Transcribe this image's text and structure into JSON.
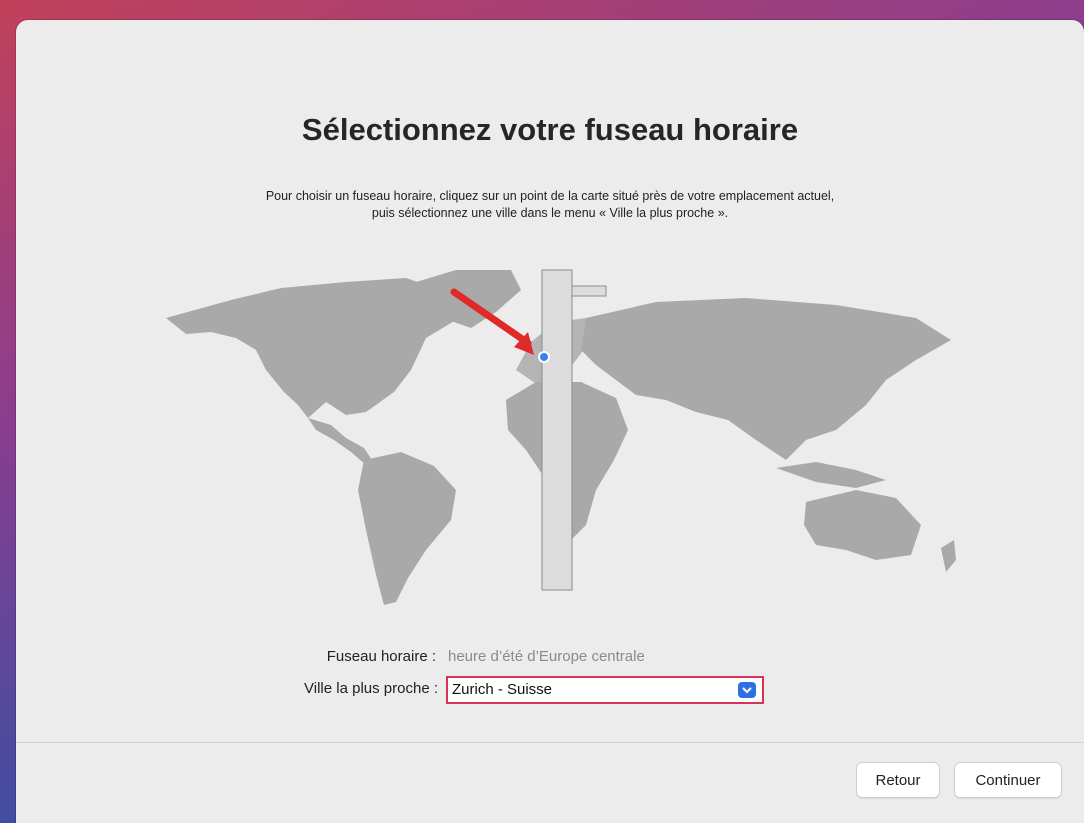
{
  "page": {
    "title": "Sélectionnez votre fuseau horaire",
    "instructions_line1": "Pour choisir un fuseau horaire, cliquez sur un point de la carte situé près de votre emplacement actuel,",
    "instructions_line2": "puis sélectionnez une ville dans le menu « Ville la plus proche »."
  },
  "timezone": {
    "label": "Fuseau horaire :",
    "value": "heure d’été d’Europe centrale"
  },
  "closest_city": {
    "label": "Ville la plus proche :",
    "selected": "Zurich - Suisse"
  },
  "buttons": {
    "back": "Retour",
    "continue": "Continuer"
  },
  "colors": {
    "highlight_border": "#d8315a",
    "select_accent": "#2f6fe4",
    "map_land": "#a9a9a9",
    "timezone_band": "#dcdcdc",
    "location_dot": "#3a7ff0",
    "annotation_arrow": "#e02a2a"
  }
}
